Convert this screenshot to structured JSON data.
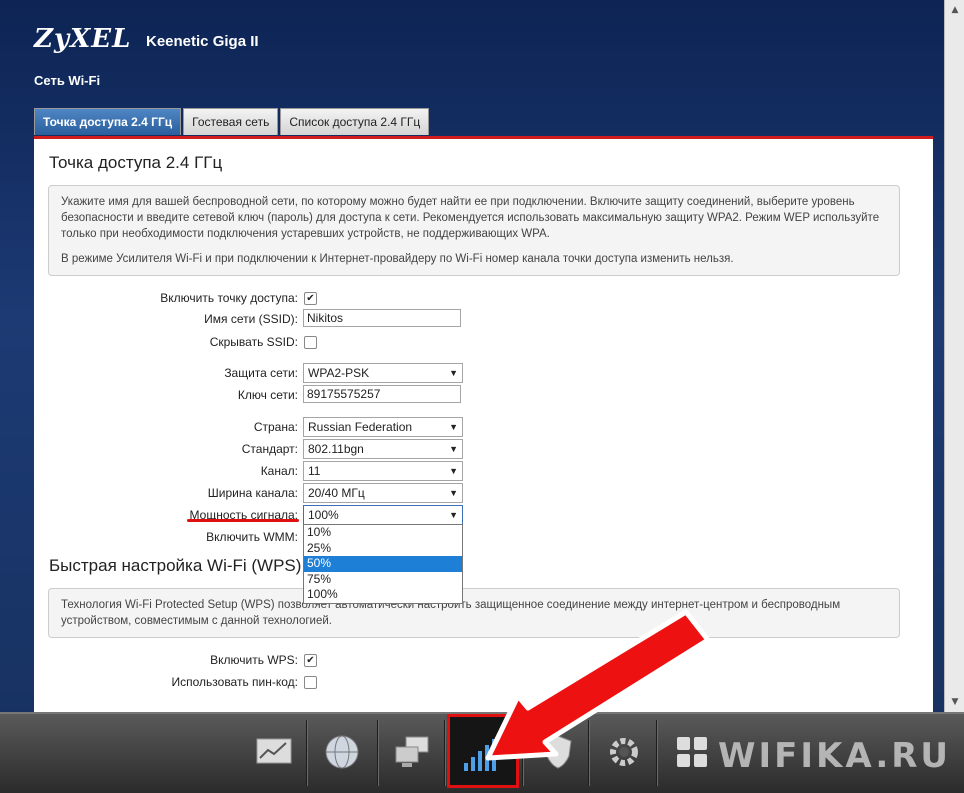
{
  "header": {
    "brand": "ZyXEL",
    "model": "Keenetic Giga II",
    "section_title": "Сеть Wi-Fi"
  },
  "tabs": [
    {
      "label": "Точка доступа 2.4 ГГц",
      "active": true
    },
    {
      "label": "Гостевая сеть",
      "active": false
    },
    {
      "label": "Список доступа 2.4 ГГц",
      "active": false
    }
  ],
  "main": {
    "title": "Точка доступа 2.4 ГГц",
    "info_p1": "Укажите имя для вашей беспроводной сети, по которому можно будет найти ее при подключении. Включите защиту соединений, выберите уровень безопасности и введите сетевой ключ (пароль) для доступа к сети. Рекомендуется использовать максимальную защиту WPA2. Режим WEP используйте только при необходимости подключения устаревших устройств, не поддерживающих WPA.",
    "info_p2": "В режиме Усилителя Wi-Fi и при подключении к Интернет-провайдеру по Wi-Fi номер канала точки доступа изменить нельзя.",
    "fields": {
      "enable_ap": {
        "label": "Включить точку доступа:",
        "checked": true
      },
      "ssid": {
        "label": "Имя сети (SSID):",
        "value": "Nikitos"
      },
      "hide_ssid": {
        "label": "Скрывать SSID:",
        "checked": false
      },
      "security": {
        "label": "Защита сети:",
        "value": "WPA2-PSK"
      },
      "key": {
        "label": "Ключ сети:",
        "value": "89175575257"
      },
      "country": {
        "label": "Страна:",
        "value": "Russian Federation"
      },
      "standard": {
        "label": "Стандарт:",
        "value": "802.11bgn"
      },
      "channel": {
        "label": "Канал:",
        "value": "11"
      },
      "width": {
        "label": "Ширина канала:",
        "value": "20/40 МГц"
      },
      "power": {
        "label": "Мощность сигнала:",
        "value": "100%",
        "options": [
          "10%",
          "25%",
          "50%",
          "75%",
          "100%"
        ],
        "highlighted": "50%"
      },
      "wmm": {
        "label": "Включить WMM:"
      }
    }
  },
  "wps": {
    "title": "Быстрая настройка Wi-Fi (WPS)",
    "info": "Технология Wi-Fi Protected Setup (WPS) позволяет автоматически настроить защищенное соединение между интернет-центром и беспроводным устройством, совместимым с данной технологией.",
    "enable": {
      "label": "Включить WPS:",
      "checked": true
    },
    "pin": {
      "label": "Использовать пин-код:",
      "checked": false
    }
  },
  "watermark": "WIFIKA.RU",
  "colors": {
    "accent_red": "#e01010",
    "tab_active": "#2a5e9d",
    "highlight": "#1e7fd7"
  }
}
